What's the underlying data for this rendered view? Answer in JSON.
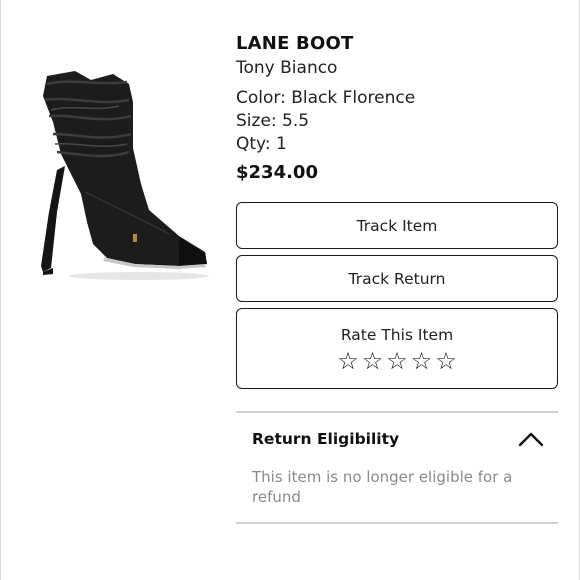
{
  "product": {
    "name": "LANE BOOT",
    "brand": "Tony Bianco",
    "color": "Color: Black Florence",
    "size": "Size: 5.5",
    "qty": "Qty: 1",
    "price": "$234.00",
    "image_icon": "ankle-boot-image"
  },
  "actions": {
    "track_item": "Track Item",
    "track_return": "Track Return",
    "rate_label": "Rate This Item",
    "star_glyph": "☆",
    "star_count": 5
  },
  "eligibility": {
    "title": "Return Eligibility",
    "message": "This item is no longer eligible for a refund",
    "expanded": true
  },
  "colors": {
    "text": "#222222",
    "muted": "#8a8a8a",
    "border": "#1a1a1a",
    "divider": "#cfcfcf"
  }
}
